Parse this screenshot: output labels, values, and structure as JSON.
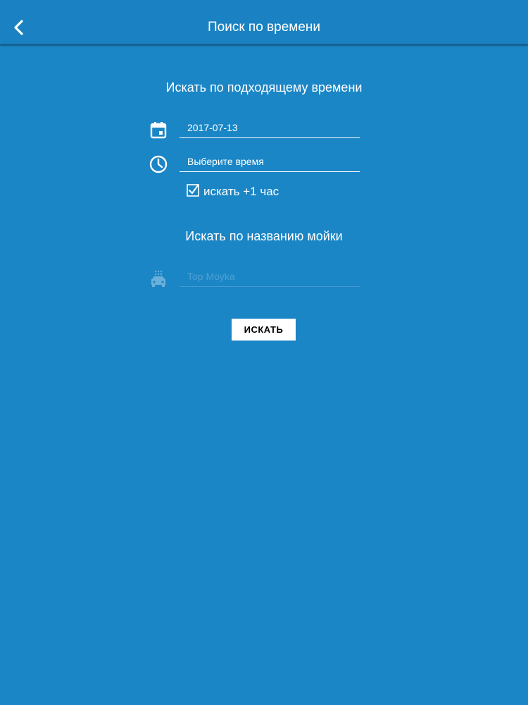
{
  "colors": {
    "background": "#1b86c6",
    "navbar": "#1a82c2",
    "text": "#ffffff",
    "button_bg": "#ffffff",
    "button_text": "#000000"
  },
  "navbar": {
    "back_icon": "chevron-left-icon",
    "title": "Поиск по времени"
  },
  "time_section": {
    "heading": "Искать по подходящему времени",
    "date_field": {
      "icon": "calendar-icon",
      "value": "2017-07-13"
    },
    "time_field": {
      "icon": "clock-icon",
      "placeholder": "Выберите время"
    },
    "plus_hour_checkbox": {
      "checked": true,
      "label": "искать +1 час"
    }
  },
  "name_section": {
    "heading": "Искать по названию мойки",
    "name_field": {
      "icon": "car-wash-icon",
      "placeholder": "Top Moyka"
    }
  },
  "search_button": {
    "label": "ИСКАТЬ"
  }
}
